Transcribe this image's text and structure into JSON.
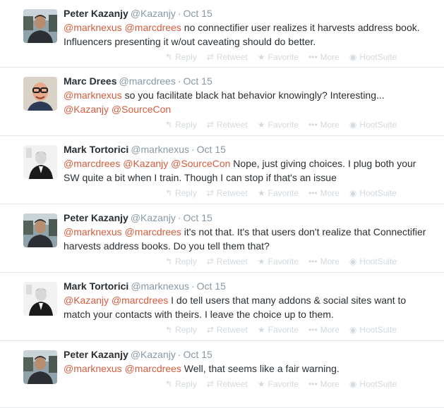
{
  "action_labels": {
    "reply": "Reply",
    "retweet": "Retweet",
    "favorite": "Favorite",
    "more": "More",
    "hootsuite": "HootSuite"
  },
  "colors": {
    "mention": "#d55c3e",
    "meta": "#8899a6",
    "action": "#d2d9de",
    "divider": "#e1e8ed"
  },
  "tweets": [
    {
      "name": "Peter Kazanjy",
      "handle": "@Kazanjy",
      "time": "Oct 15",
      "avatar": "peter-kazanjy-photo",
      "segments": [
        {
          "type": "mention",
          "text": "@marknexus"
        },
        {
          "type": "text",
          "text": " "
        },
        {
          "type": "mention",
          "text": "@marcdrees"
        },
        {
          "type": "text",
          "text": " no connectifier user realizes it harvests address book. Influencers presenting it w/out caveating should do better."
        }
      ]
    },
    {
      "name": "Marc Drees",
      "handle": "@marcdrees",
      "time": "Oct 15",
      "avatar": "marc-drees-photo",
      "segments": [
        {
          "type": "mention",
          "text": "@marknexus"
        },
        {
          "type": "text",
          "text": " so you facilitate black hat behavior knowingly? Interesting... "
        },
        {
          "type": "mention",
          "text": "@Kazanjy"
        },
        {
          "type": "text",
          "text": " "
        },
        {
          "type": "mention",
          "text": "@SourceCon"
        }
      ]
    },
    {
      "name": "Mark Tortorici",
      "handle": "@marknexus",
      "time": "Oct 15",
      "avatar": "mark-tortorici-photo",
      "segments": [
        {
          "type": "mention",
          "text": "@marcdrees"
        },
        {
          "type": "text",
          "text": " "
        },
        {
          "type": "mention",
          "text": "@Kazanjy"
        },
        {
          "type": "text",
          "text": " "
        },
        {
          "type": "mention",
          "text": "@SourceCon"
        },
        {
          "type": "text",
          "text": " Nope, just giving choices. I plug both your SW quite a bit when I train. Though I can stop if that's an issue"
        }
      ]
    },
    {
      "name": "Peter Kazanjy",
      "handle": "@Kazanjy",
      "time": "Oct 15",
      "avatar": "peter-kazanjy-photo",
      "segments": [
        {
          "type": "mention",
          "text": "@marknexus"
        },
        {
          "type": "text",
          "text": " "
        },
        {
          "type": "mention",
          "text": "@marcdrees"
        },
        {
          "type": "text",
          "text": " it's not that. It's that users don't realize that Connectifier harvests address books. Do you tell them that?"
        }
      ]
    },
    {
      "name": "Mark Tortorici",
      "handle": "@marknexus",
      "time": "Oct 15",
      "avatar": "mark-tortorici-photo",
      "segments": [
        {
          "type": "mention",
          "text": "@Kazanjy"
        },
        {
          "type": "text",
          "text": " "
        },
        {
          "type": "mention",
          "text": "@marcdrees"
        },
        {
          "type": "text",
          "text": " I do tell users that many addons & social sites want to match your contacts with theirs. I leave the choice up to them."
        }
      ]
    },
    {
      "name": "Peter Kazanjy",
      "handle": "@Kazanjy",
      "time": "Oct 15",
      "avatar": "peter-kazanjy-photo",
      "segments": [
        {
          "type": "mention",
          "text": "@marknexus"
        },
        {
          "type": "text",
          "text": " "
        },
        {
          "type": "mention",
          "text": "@marcdrees"
        },
        {
          "type": "text",
          "text": " Well, that seems like a fair warning."
        }
      ]
    }
  ]
}
